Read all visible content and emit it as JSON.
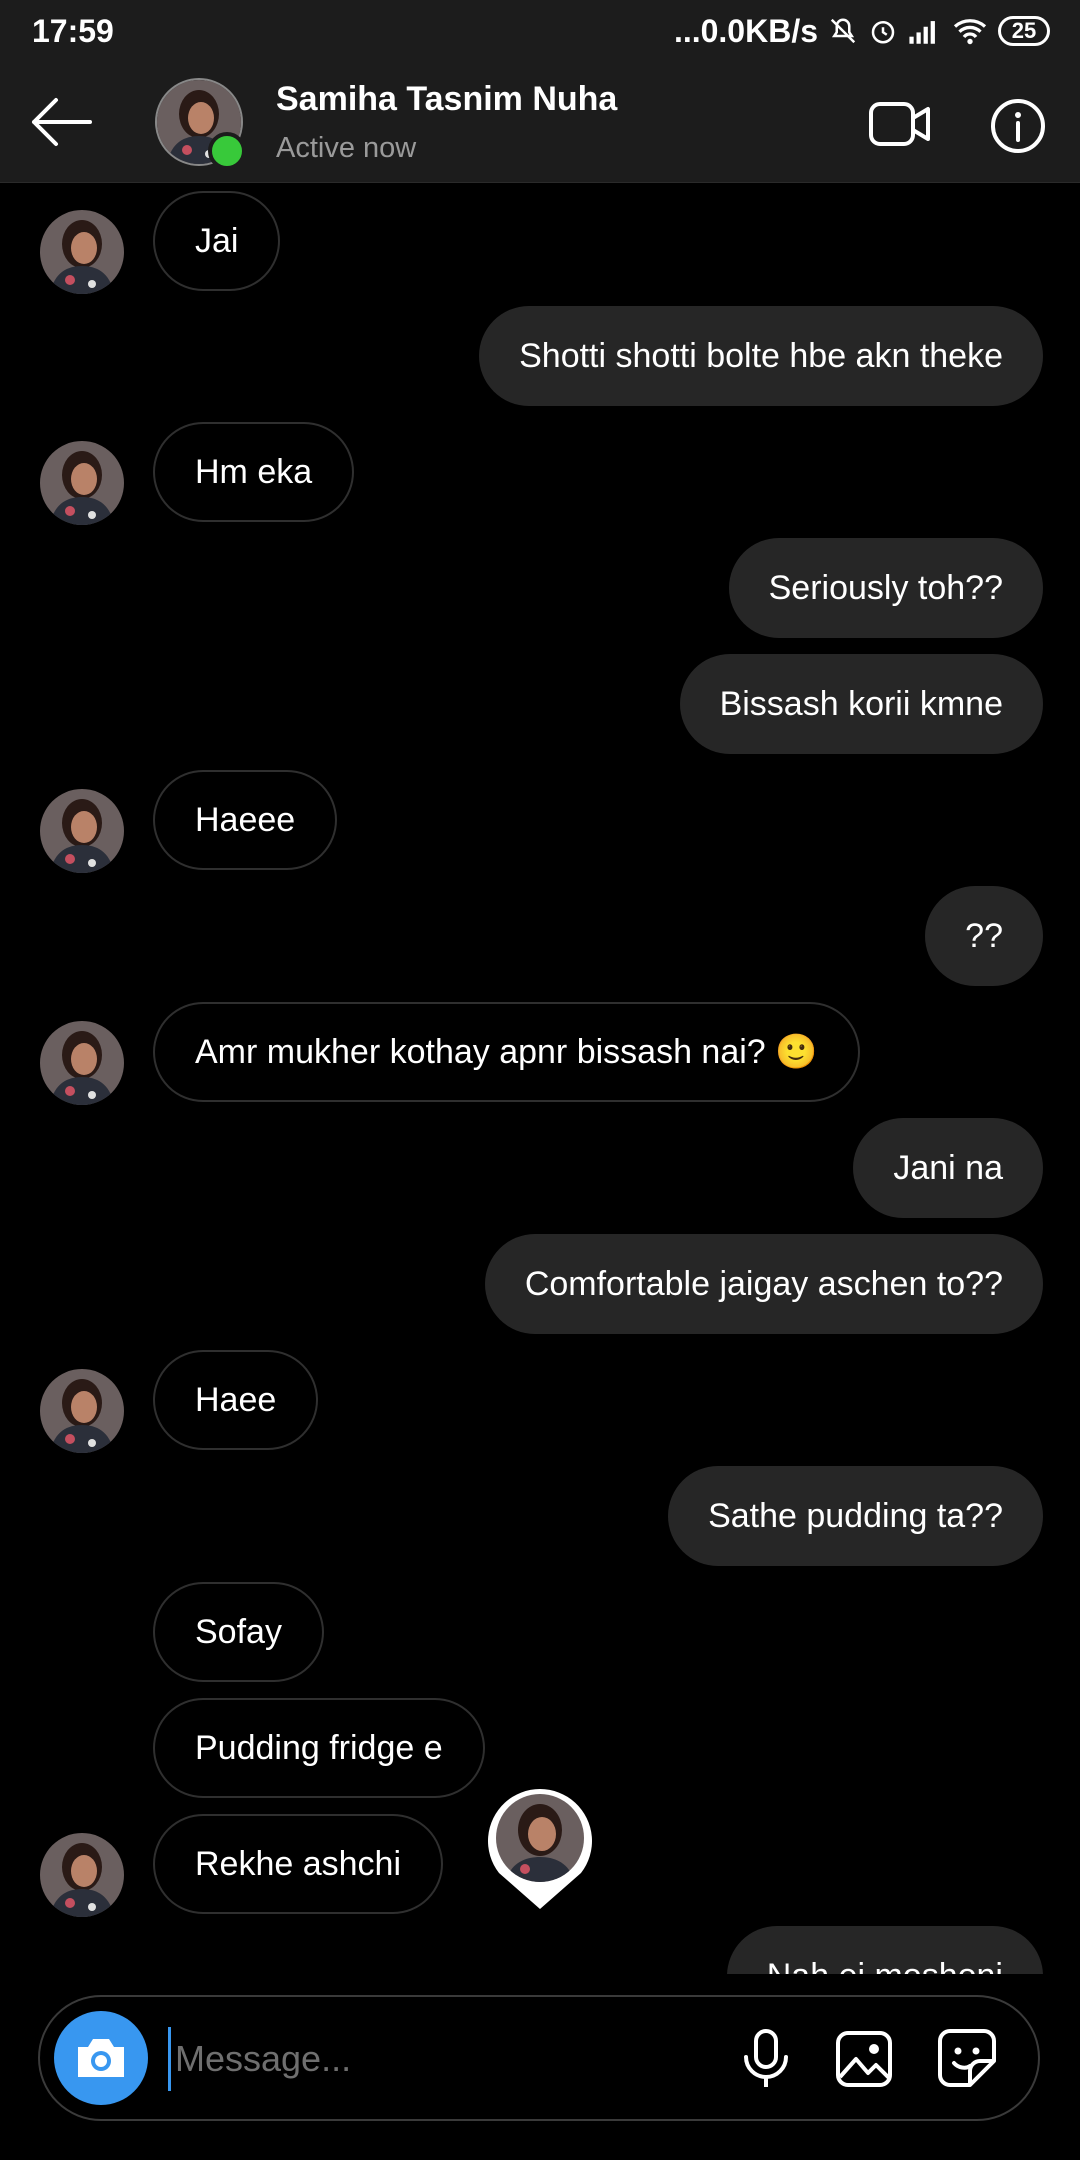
{
  "status_bar": {
    "time": "17:59",
    "network_speed": "...0.0KB/s",
    "battery": "25",
    "icons": [
      "mute-bell-icon",
      "alarm-icon",
      "signal-icon",
      "wifi-icon",
      "battery-icon"
    ]
  },
  "header": {
    "name": "Samiha Tasnim Nuha",
    "status": "Active now",
    "online_color": "#38c93a"
  },
  "messages": [
    {
      "dir": "in",
      "text": "Jai",
      "avatar": true
    },
    {
      "dir": "out",
      "text": "Shotti shotti bolte hbe akn theke"
    },
    {
      "dir": "in",
      "text": "Hm eka",
      "avatar": true
    },
    {
      "dir": "out",
      "text": "Seriously toh??"
    },
    {
      "dir": "out",
      "text": "Bissash korii kmne"
    },
    {
      "dir": "in",
      "text": "Haeee",
      "avatar": true
    },
    {
      "dir": "out",
      "text": "??"
    },
    {
      "dir": "in",
      "text": "Amr mukher kothay apnr bissash nai? 🙂",
      "avatar": true
    },
    {
      "dir": "out",
      "text": "Jani na"
    },
    {
      "dir": "out",
      "text": "Comfortable jaigay aschen to??"
    },
    {
      "dir": "in",
      "text": "Haee",
      "avatar": true
    },
    {
      "dir": "out",
      "text": "Sathe pudding ta??"
    },
    {
      "dir": "in",
      "text": "Sofay"
    },
    {
      "dir": "in",
      "text": "Pudding fridge e"
    },
    {
      "dir": "in",
      "text": "Rekhe ashchi",
      "avatar": true
    }
  ],
  "partial_message": "Nah ei moshoni",
  "composer": {
    "placeholder": "Message...",
    "accent_color": "#3897f0"
  }
}
